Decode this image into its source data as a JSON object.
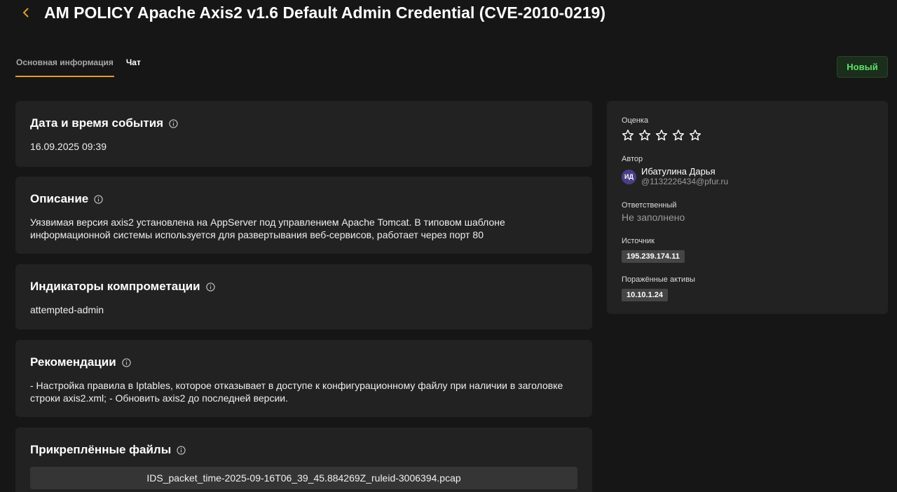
{
  "header": {
    "title": "AM POLICY Apache Axis2 v1.6 Default Admin Credential (CVE-2010-0219)",
    "back_icon": "chevron-left-icon",
    "accent_color": "#e09a2d"
  },
  "tabs": [
    {
      "label": "Основная информация",
      "active": true
    },
    {
      "label": "Чат",
      "active": false
    }
  ],
  "status": {
    "label": "Новый",
    "color": "#5fe06a"
  },
  "cards": {
    "datetime": {
      "title": "Дата и время события",
      "value": "16.09.2025 09:39"
    },
    "description": {
      "title": "Описание",
      "value": "Уязвимая версия axis2 установлена на AppServer под управлением Apache Tomcat. В типовом шаблоне информационной системы используется для развертывания веб-сервисов, работает через порт 80"
    },
    "indicators": {
      "title": "Индикаторы компрометации",
      "value": "attempted-admin"
    },
    "recommendations": {
      "title": "Рекомендации",
      "value": "- Настройка правила в Iptables, которое отказывает в доступе к конфигурационному файлу при наличии в заголовке строки axis2.xml; - Обновить axis2 до последней версии."
    },
    "files": {
      "title": "Прикреплённые файлы",
      "items": [
        "IDS_packet_time-2025-09-16T06_39_45.884269Z_ruleid-3006394.pcap"
      ]
    }
  },
  "sidebar": {
    "rating": {
      "label": "Оценка",
      "value": 0,
      "max": 5
    },
    "author": {
      "label": "Автор",
      "initials": "ИД",
      "name": "Ибатулина Дарья",
      "handle": "@1132226434@pfur.ru"
    },
    "assignee": {
      "label": "Ответственный",
      "value": "Не заполнено"
    },
    "source": {
      "label": "Источник",
      "value": "195.239.174.11"
    },
    "assets": {
      "label": "Поражённые активы",
      "value": "10.10.1.24"
    }
  }
}
